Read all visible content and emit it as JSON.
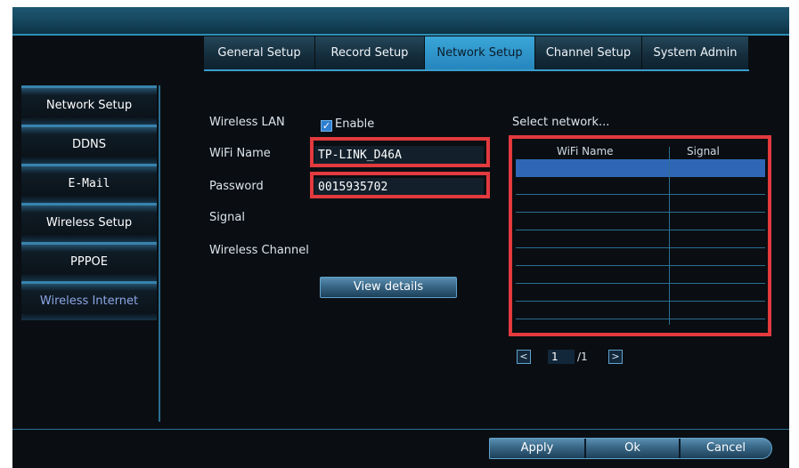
{
  "tabs": [
    {
      "label": "General Setup"
    },
    {
      "label": "Record Setup"
    },
    {
      "label": "Network Setup"
    },
    {
      "label": "Channel Setup"
    },
    {
      "label": "System Admin"
    }
  ],
  "sidebar": {
    "items": [
      {
        "label": "Network Setup"
      },
      {
        "label": "DDNS"
      },
      {
        "label": "E-Mail"
      },
      {
        "label": "Wireless Setup"
      },
      {
        "label": "PPPOE"
      },
      {
        "label": "Wireless Internet"
      }
    ]
  },
  "form": {
    "wireless_lan_label": "Wireless LAN",
    "enable_label": "Enable",
    "enable_checked": true,
    "wifi_name_label": "WiFi Name",
    "wifi_name_value": "TP-LINK_D46A",
    "password_label": "Password",
    "password_value": "0015935702",
    "signal_label": "Signal",
    "channel_label": "Wireless Channel",
    "view_details_label": "View details"
  },
  "network": {
    "title": "Select network...",
    "col_name": "WiFi Name",
    "col_signal": "Signal",
    "current_page": "1",
    "total_pages": "/1",
    "prev_label": "<",
    "next_label": ">"
  },
  "footer": {
    "apply_label": "Apply",
    "ok_label": "Ok",
    "cancel_label": "Cancel"
  },
  "colors": {
    "accent": "#3aa6d8",
    "highlight_box": "#e23a3e",
    "selected_row": "#2f67b6"
  }
}
